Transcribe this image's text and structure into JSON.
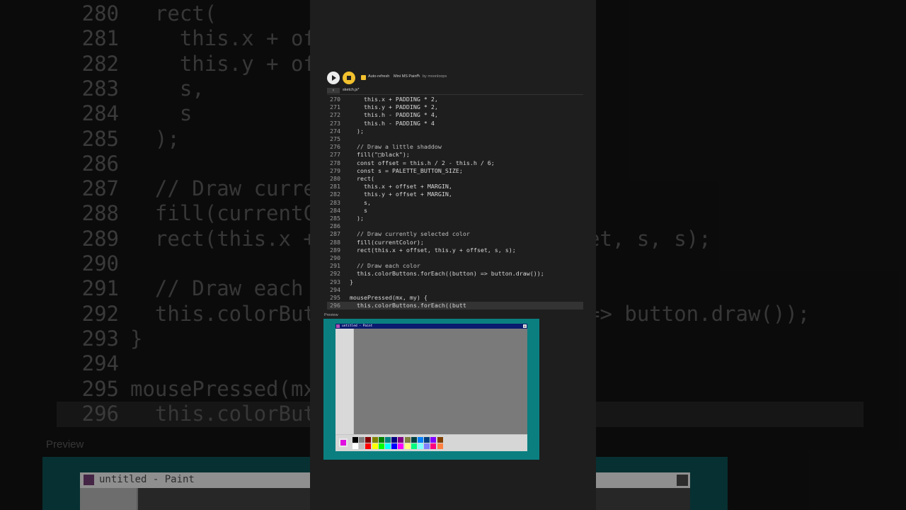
{
  "toolbar": {
    "auto_refresh_label": "Auto-refresh",
    "sketch_name": "Mini MS Paint",
    "author": "by moonloops"
  },
  "file": {
    "tab_name": "sketch.js*"
  },
  "preview": {
    "label": "Preview"
  },
  "paint": {
    "title": "untitled - Paint",
    "close_label": "x"
  },
  "colors": {
    "accent": "#f2c12e",
    "teal": "#0b7f80",
    "current_color": "#e011e0"
  },
  "palette_top": [
    "#000000",
    "#808080",
    "#800000",
    "#808000",
    "#008000",
    "#008080",
    "#000080",
    "#800080",
    "#808040",
    "#004040",
    "#0080ff",
    "#004080",
    "#8000ff",
    "#804000"
  ],
  "palette_bottom": [
    "#ffffff",
    "#c0c0c0",
    "#ff0000",
    "#ffff00",
    "#00ff00",
    "#00ffff",
    "#0000ff",
    "#ff00ff",
    "#ffff80",
    "#00ff80",
    "#80ffff",
    "#8080ff",
    "#ff0080",
    "#ff8040"
  ],
  "code_lines": [
    {
      "n": "270",
      "t": "    this.x + PADDING * 2,"
    },
    {
      "n": "271",
      "t": "    this.y + PADDING * 2,"
    },
    {
      "n": "272",
      "t": "    this.h - PADDING * 4,"
    },
    {
      "n": "273",
      "t": "    this.h - PADDING * 4"
    },
    {
      "n": "274",
      "t": "  );"
    },
    {
      "n": "275",
      "t": ""
    },
    {
      "n": "276",
      "t": "  // Draw a little shaddow"
    },
    {
      "n": "277",
      "t": "  fill(\"□black\");"
    },
    {
      "n": "278",
      "t": "  const offset = this.h / 2 - this.h / 6;"
    },
    {
      "n": "279",
      "t": "  const s = PALETTE_BUTTON_SIZE;"
    },
    {
      "n": "280",
      "t": "  rect("
    },
    {
      "n": "281",
      "t": "    this.x + offset + MARGIN,"
    },
    {
      "n": "282",
      "t": "    this.y + offset + MARGIN,"
    },
    {
      "n": "283",
      "t": "    s,"
    },
    {
      "n": "284",
      "t": "    s"
    },
    {
      "n": "285",
      "t": "  );"
    },
    {
      "n": "286",
      "t": ""
    },
    {
      "n": "287",
      "t": "  // Draw currently selected color"
    },
    {
      "n": "288",
      "t": "  fill(currentColor);"
    },
    {
      "n": "289",
      "t": "  rect(this.x + offset, this.y + offset, s, s);"
    },
    {
      "n": "290",
      "t": ""
    },
    {
      "n": "291",
      "t": "  // Draw each color"
    },
    {
      "n": "292",
      "t": "  this.colorButtons.forEach((button) => button.draw());"
    },
    {
      "n": "293",
      "t": "}"
    },
    {
      "n": "294",
      "t": ""
    },
    {
      "n": "295",
      "t": "mousePressed(mx, my) {"
    },
    {
      "n": "296",
      "t": "  this.colorButtons.forEach((butt"
    }
  ],
  "bg_lines": [
    {
      "n": "280",
      "t": "  rect("
    },
    {
      "n": "281",
      "t": "    this.x + offset"
    },
    {
      "n": "282",
      "t": "    this.y + offset"
    },
    {
      "n": "283",
      "t": "    s,"
    },
    {
      "n": "284",
      "t": "    s"
    },
    {
      "n": "285",
      "t": "  );"
    },
    {
      "n": "286",
      "t": ""
    },
    {
      "n": "287",
      "t": "  // Draw currently selected color"
    },
    {
      "n": "288",
      "t": "  fill(currentColor);"
    },
    {
      "n": "289",
      "t": "  rect(this.x + offset, this.y + offset, s, s);"
    },
    {
      "n": "290",
      "t": ""
    },
    {
      "n": "291",
      "t": "  // Draw each color"
    },
    {
      "n": "292",
      "t": "  this.colorButtons.forEach((button) => button.draw());"
    },
    {
      "n": "293",
      "t": "}"
    },
    {
      "n": "294",
      "t": ""
    },
    {
      "n": "295",
      "t": "mousePressed(mx, my) {"
    },
    {
      "n": "296",
      "t": "  this.colorButtons.forEach((butt"
    }
  ],
  "icons": {
    "play": "play-icon",
    "stop": "stop-icon",
    "pencil": "pencil-icon",
    "chevron": "chevron-right-icon"
  }
}
